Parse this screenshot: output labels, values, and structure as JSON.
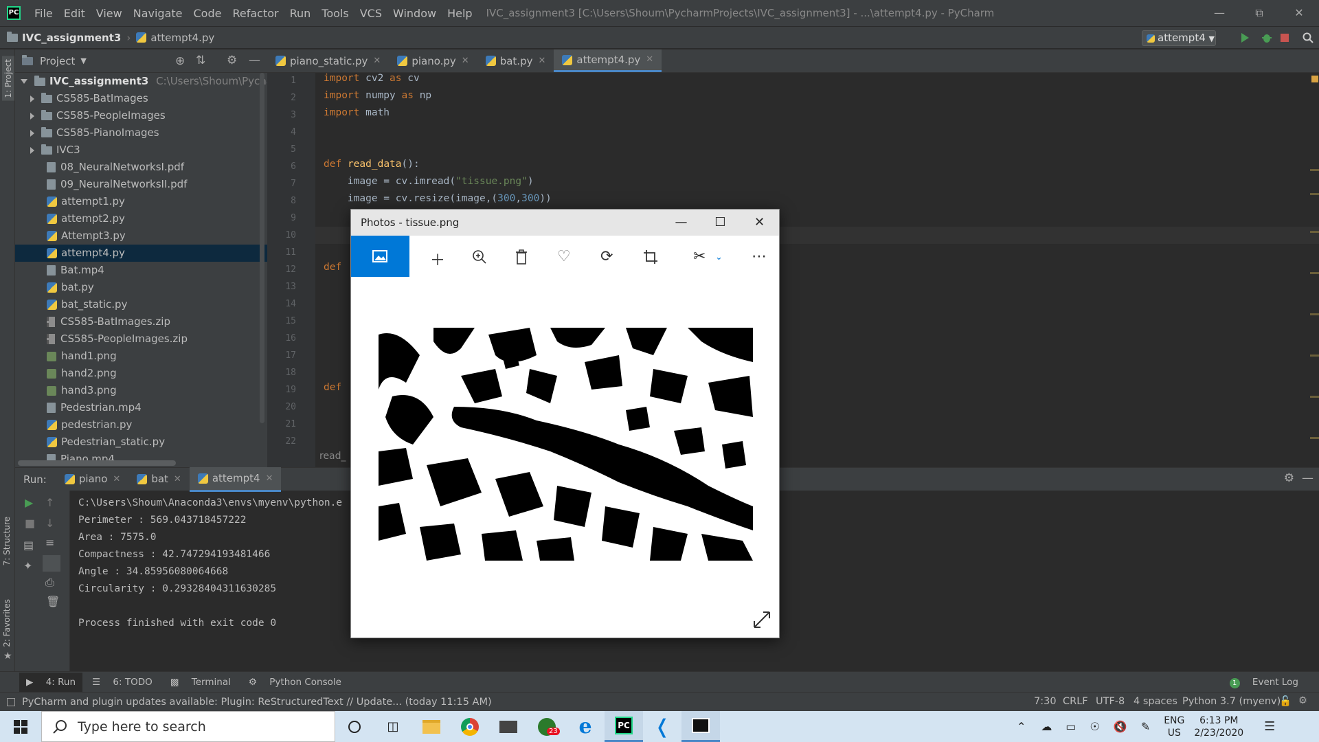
{
  "titlebar": {
    "menu": [
      "File",
      "Edit",
      "View",
      "Navigate",
      "Code",
      "Refactor",
      "Run",
      "Tools",
      "VCS",
      "Window",
      "Help"
    ],
    "window_title": "IVC_assignment3 [C:\\Users\\Shoum\\PycharmProjects\\IVC_assignment3] - ...\\attempt4.py - PyCharm"
  },
  "navbar": {
    "project": "IVC_assignment3",
    "file": "attempt4.py",
    "run_config": "attempt4"
  },
  "sidebar_labels": {
    "project": "1: Project",
    "structure": "7: Structure",
    "favorites": "2: Favorites"
  },
  "project_panel": {
    "title": "Project",
    "root": {
      "name": "IVC_assignment3",
      "path": "C:\\Users\\Shoum\\PycharmProjects\\IVC_assignment3"
    },
    "items": [
      {
        "name": "CS585-BatImages",
        "type": "folder"
      },
      {
        "name": "CS585-PeopleImages",
        "type": "folder"
      },
      {
        "name": "CS585-PianoImages",
        "type": "folder"
      },
      {
        "name": "IVC3",
        "type": "folder"
      },
      {
        "name": "08_NeuralNetworksI.pdf",
        "type": "file"
      },
      {
        "name": "09_NeuralNetworksII.pdf",
        "type": "file"
      },
      {
        "name": "attempt1.py",
        "type": "py"
      },
      {
        "name": "attempt2.py",
        "type": "py"
      },
      {
        "name": "Attempt3.py",
        "type": "py"
      },
      {
        "name": "attempt4.py",
        "type": "py",
        "selected": true
      },
      {
        "name": "Bat.mp4",
        "type": "file"
      },
      {
        "name": "bat.py",
        "type": "py"
      },
      {
        "name": "bat_static.py",
        "type": "py"
      },
      {
        "name": "CS585-BatImages.zip",
        "type": "zip"
      },
      {
        "name": "CS585-PeopleImages.zip",
        "type": "zip"
      },
      {
        "name": "hand1.png",
        "type": "img"
      },
      {
        "name": "hand2.png",
        "type": "img"
      },
      {
        "name": "hand3.png",
        "type": "img"
      },
      {
        "name": "Pedestrian.mp4",
        "type": "file"
      },
      {
        "name": "pedestrian.py",
        "type": "py"
      },
      {
        "name": "Pedestrian_static.py",
        "type": "py"
      },
      {
        "name": "Piano.mp4",
        "type": "file"
      }
    ]
  },
  "editor": {
    "tabs": [
      {
        "label": "piano_static.py",
        "active": false
      },
      {
        "label": "piano.py",
        "active": false
      },
      {
        "label": "bat.py",
        "active": false
      },
      {
        "label": "attempt4.py",
        "active": true
      }
    ],
    "line_numbers": [
      "1",
      "2",
      "3",
      "4",
      "5",
      "6",
      "7",
      "8",
      "9",
      "10",
      "11",
      "12",
      "13",
      "14",
      "15",
      "16",
      "17",
      "18",
      "19",
      "20",
      "21",
      "22"
    ],
    "breadcrumb": "read_"
  },
  "photos": {
    "title": "Photos - tissue.png",
    "toolbar_icons": [
      "image-icon",
      "add-icon",
      "zoom-icon",
      "delete-icon",
      "favorite-icon",
      "rotate-icon",
      "crop-icon",
      "edit-icon",
      "more-icon"
    ]
  },
  "run_panel": {
    "label": "Run:",
    "tabs": [
      {
        "label": "piano"
      },
      {
        "label": "bat"
      },
      {
        "label": "attempt4",
        "active": true
      }
    ],
    "output": [
      "C:\\Users\\Shoum\\Anaconda3\\envs\\myenv\\python.e",
      "Perimeter : 569.043718457222",
      "Area : 7575.0",
      "Compactness : 42.747294193481466",
      "Angle : 34.85956080064668",
      "Circularity : 0.29328404311630285",
      "",
      "Process finished with exit code 0"
    ]
  },
  "bottom_tabs": {
    "run": "4: Run",
    "todo": "6: TODO",
    "terminal": "Terminal",
    "python_console": "Python Console",
    "event_log": "Event Log",
    "event_count": "1"
  },
  "statusbar": {
    "message": "PyCharm and plugin updates available: Plugin: ReStructuredText // Update... (today 11:15 AM)",
    "position": "7:30",
    "line_sep": "CRLF",
    "encoding": "UTF-8",
    "indent": "4 spaces",
    "interpreter": "Python 3.7 (myenv)"
  },
  "taskbar": {
    "search_placeholder": "Type here to search",
    "lang": "ENG",
    "region": "US",
    "time": "6:13 PM",
    "date": "2/23/2020",
    "badge": "23"
  }
}
